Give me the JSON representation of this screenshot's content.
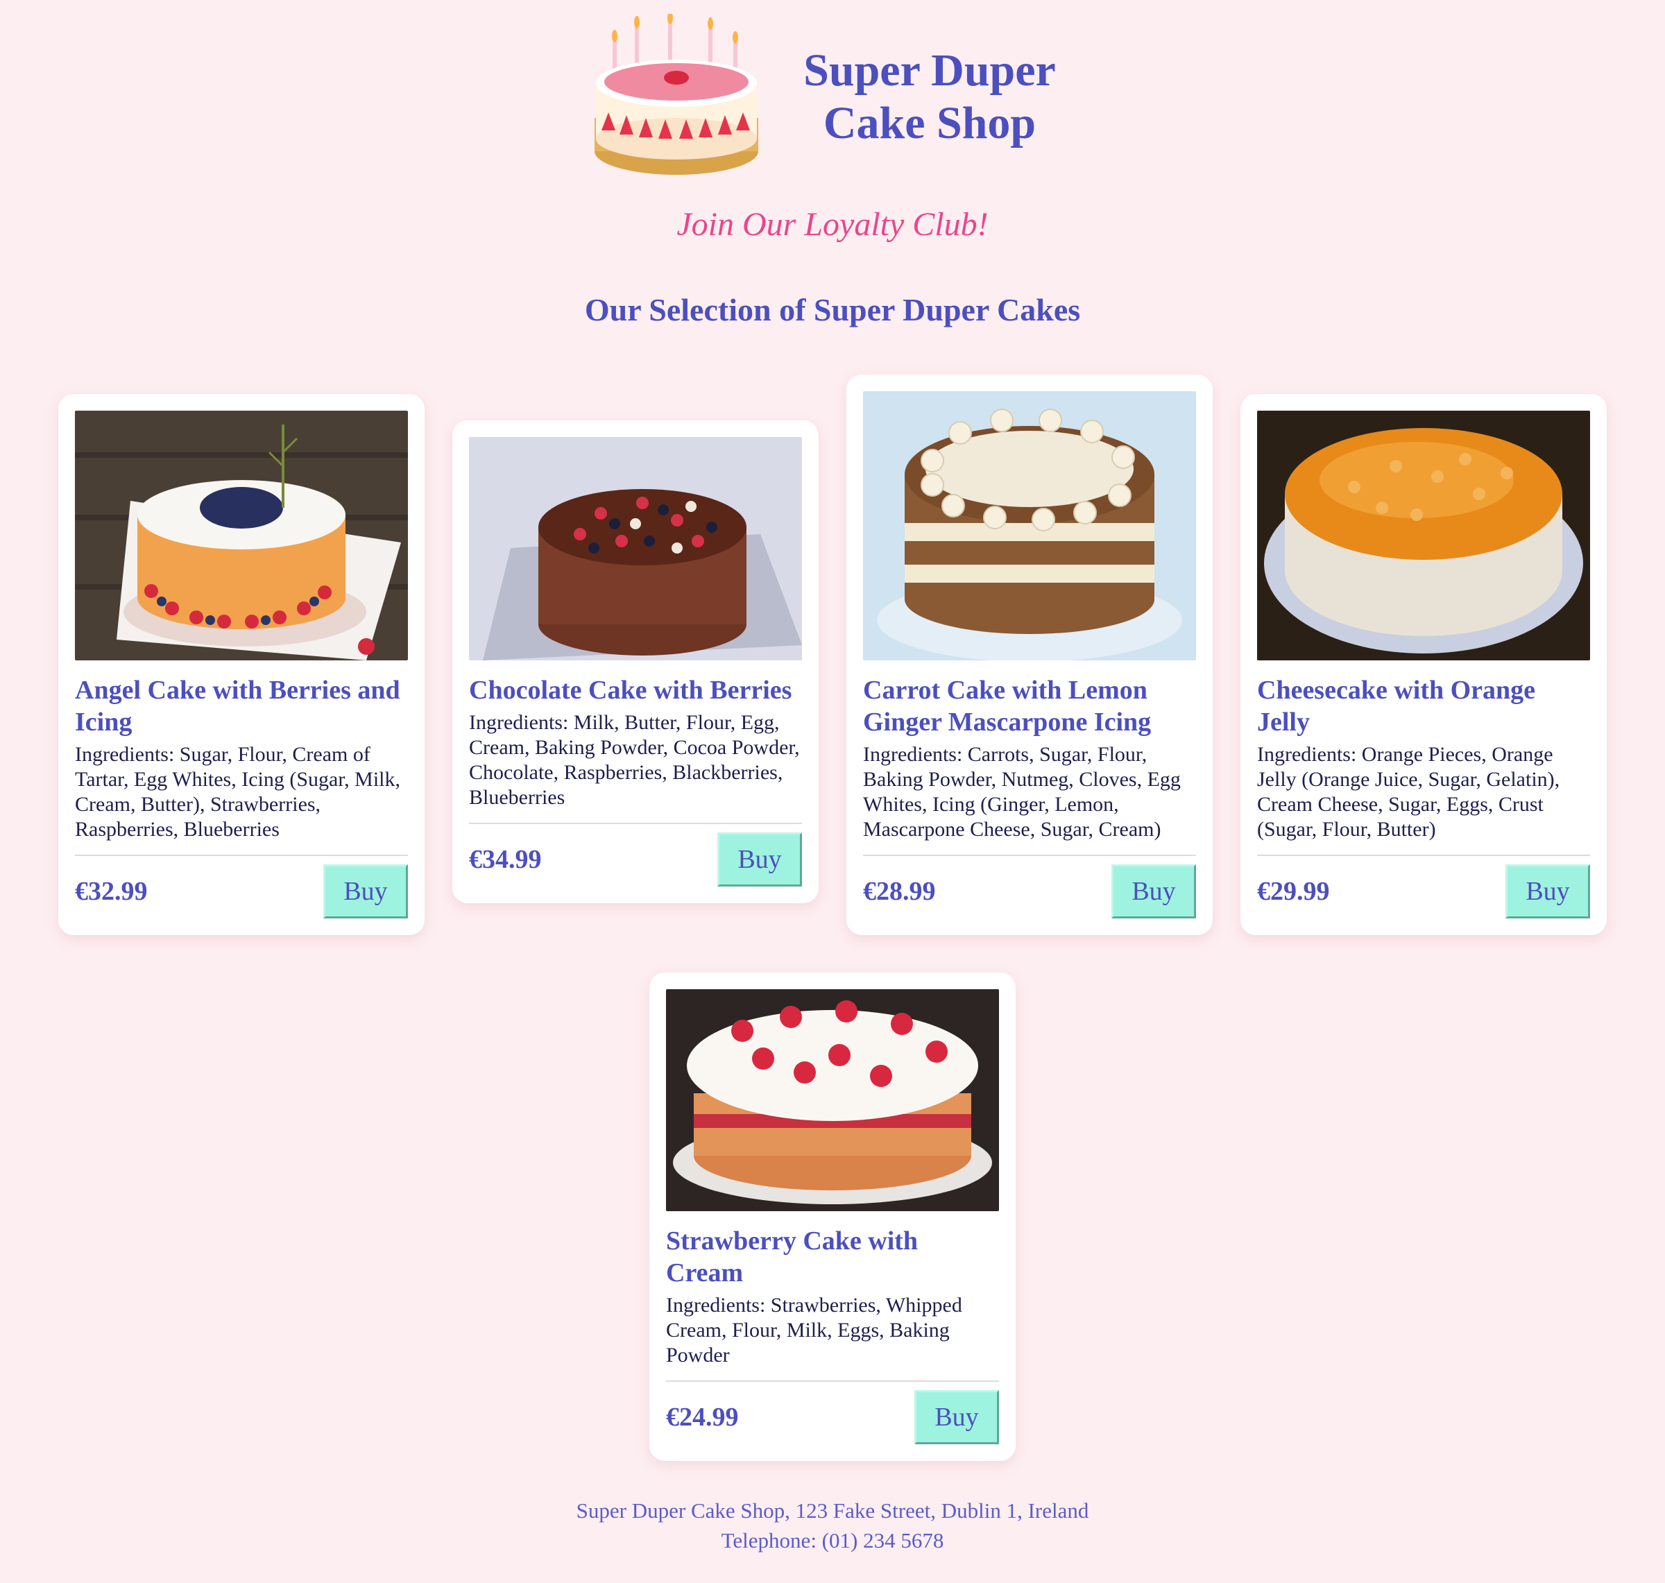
{
  "header": {
    "title_line1": "Super Duper",
    "title_line2": "Cake Shop",
    "logo_icon": "birthday-cake-icon"
  },
  "loyalty": "Join Our Loyalty Club!",
  "selection_heading": "Our Selection of Super Duper Cakes",
  "colors": {
    "background": "#fdeef1",
    "accent": "#4c4fbe",
    "loyalty": "#e9468a",
    "buy_button": "#9ef3e0"
  },
  "cakes": [
    {
      "name": "Angel Cake with Berries and Icing",
      "ingredients": "Ingredients: Sugar, Flour, Cream of Tartar, Egg Whites, Icing (Sugar, Milk, Cream, Butter), Strawberries, Raspberries, Blueberries",
      "price": "€32.99",
      "buy_label": "Buy"
    },
    {
      "name": "Chocolate Cake with Berries",
      "ingredients": "Ingredients: Milk, Butter, Flour, Egg, Cream, Baking Powder, Cocoa Powder, Chocolate, Raspberries, Blackberries, Blueberries",
      "price": "€34.99",
      "buy_label": "Buy"
    },
    {
      "name": "Carrot Cake with Lemon Ginger Mascarpone Icing",
      "ingredients": "Ingredients: Carrots, Sugar, Flour, Baking Powder, Nutmeg, Cloves, Egg Whites, Icing (Ginger, Lemon, Mascarpone Cheese, Sugar, Cream)",
      "price": "€28.99",
      "buy_label": "Buy"
    },
    {
      "name": "Cheesecake with Orange Jelly",
      "ingredients": "Ingredients: Orange Pieces, Orange Jelly (Orange Juice, Sugar, Gelatin), Cream Cheese, Sugar, Eggs, Crust (Sugar, Flour, Butter)",
      "price": "€29.99",
      "buy_label": "Buy"
    },
    {
      "name": "Strawberry Cake with Cream",
      "ingredients": "Ingredients: Strawberries, Whipped Cream, Flour, Milk, Eggs, Baking Powder",
      "price": "€24.99",
      "buy_label": "Buy"
    }
  ],
  "footer": {
    "address": "Super Duper Cake Shop, 123 Fake Street, Dublin 1, Ireland",
    "telephone": "Telephone: (01) 234 5678"
  }
}
